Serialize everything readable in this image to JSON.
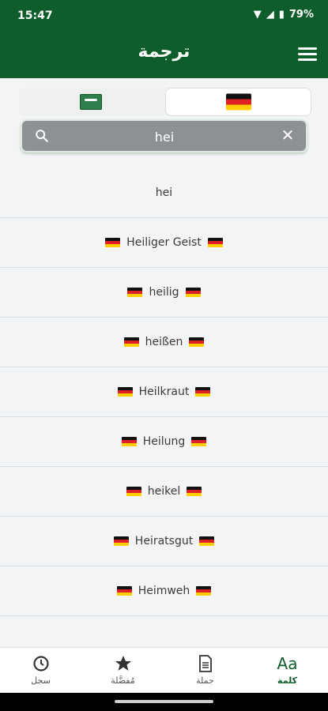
{
  "status_bar": {
    "time": "15:47",
    "battery": "79%"
  },
  "app_bar": {
    "title": "ترجمة"
  },
  "language_toggle": {
    "left": {
      "icon": "saudi-flag-icon"
    },
    "right": {
      "icon": "germany-flag-icon",
      "selected": true
    }
  },
  "search": {
    "value": "hei",
    "placeholder": ""
  },
  "results": [
    {
      "text": "hei",
      "flags": false
    },
    {
      "text": "Heiliger Geist",
      "flags": true
    },
    {
      "text": "heilig",
      "flags": true
    },
    {
      "text": "heißen",
      "flags": true
    },
    {
      "text": "Heilkraut",
      "flags": true
    },
    {
      "text": "Heilung",
      "flags": true
    },
    {
      "text": "heikel",
      "flags": true
    },
    {
      "text": "Heiratsgut",
      "flags": true
    },
    {
      "text": "Heimweh",
      "flags": true
    }
  ],
  "bottom_nav": {
    "history": "سجل",
    "favorites": "مُفضَّلة",
    "sentence": "جملة",
    "word": "كلمة",
    "word_icon_text": "Aa"
  },
  "colors": {
    "primary": "#0f5d2a",
    "accent_active": "#0f5d2a"
  }
}
